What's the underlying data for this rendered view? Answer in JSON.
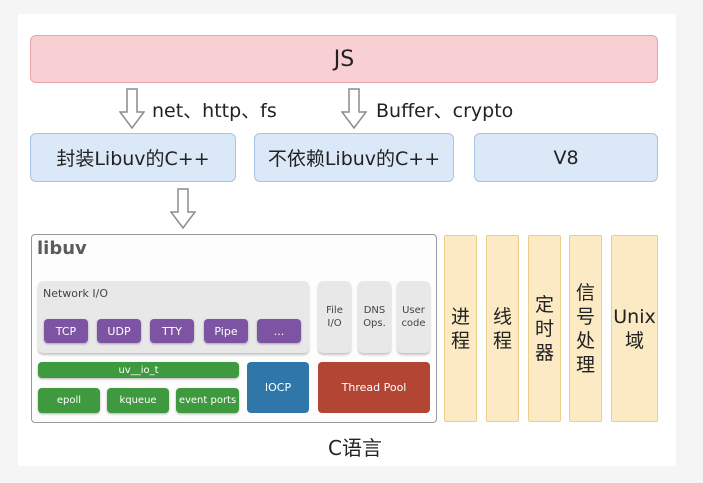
{
  "js_layer": {
    "label": "JS"
  },
  "arrows": [
    {
      "label": "net、http、fs"
    },
    {
      "label": "Buffer、crypto"
    }
  ],
  "cpp_layer": {
    "libuv_wrapped": "封装Libuv的C++",
    "non_libuv": "不依赖Libuv的C++",
    "v8": "V8"
  },
  "libuv": {
    "title": "libuv",
    "network_io": {
      "label": "Network I/O",
      "items": [
        "TCP",
        "UDP",
        "TTY",
        "Pipe",
        "..."
      ]
    },
    "file_io": "File\nI/O",
    "dns_ops": "DNS\nOps.",
    "user_code": "User\ncode",
    "uv_io_t": "uv__io_t",
    "pollers": [
      "epoll",
      "kqueue",
      "event ports"
    ],
    "iocp": "IOCP",
    "thread_pool": "Thread Pool"
  },
  "system_columns": [
    {
      "label": "进\n程"
    },
    {
      "label": "线\n程"
    },
    {
      "label": "定\n时\n器"
    },
    {
      "label": "信\n号\n处\n理"
    },
    {
      "label": "Unix\n域"
    }
  ],
  "footer": {
    "label": "C语言"
  },
  "colors": {
    "js_fill": "#f8cfd2",
    "cpp_fill": "#dbe8f7",
    "network_item_fill": "#7d54a3",
    "poller_fill": "#3f9a3f",
    "iocp_fill": "#2f77a8",
    "thread_pool_fill": "#b24534",
    "system_column_fill": "#fbeac3"
  }
}
